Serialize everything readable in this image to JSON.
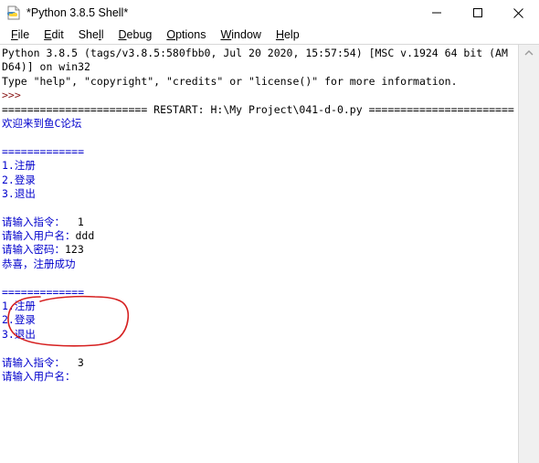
{
  "window": {
    "title": "*Python 3.8.5 Shell*",
    "icon": "python-idle-icon",
    "controls": [
      {
        "name": "minimize-button",
        "glyph": "minimize"
      },
      {
        "name": "maximize-button",
        "glyph": "maximize"
      },
      {
        "name": "close-button",
        "glyph": "close"
      }
    ]
  },
  "menubar": {
    "items": [
      {
        "label": "File",
        "mnemonic": "F"
      },
      {
        "label": "Edit",
        "mnemonic": "E"
      },
      {
        "label": "Shell",
        "mnemonic": "l"
      },
      {
        "label": "Debug",
        "mnemonic": "D"
      },
      {
        "label": "Options",
        "mnemonic": "O"
      },
      {
        "label": "Window",
        "mnemonic": "W"
      },
      {
        "label": "Help",
        "mnemonic": "H"
      }
    ]
  },
  "shell": {
    "lines": [
      {
        "text": "Python 3.8.5 (tags/v3.8.5:580fbb0, Jul 20 2020, 15:57:54) [MSC v.1924 64 bit (AM",
        "color": "black"
      },
      {
        "text": "D64)] on win32",
        "color": "black"
      },
      {
        "text": "Type \"help\", \"copyright\", \"credits\" or \"license()\" for more information.",
        "color": "black"
      },
      {
        "text": ">>>",
        "color": "red"
      },
      {
        "text": "======================= RESTART: H:\\My Project\\041-d-0.py =======================",
        "color": "black"
      },
      {
        "text": "欢迎来到鱼C论坛",
        "color": "blue"
      },
      {
        "text": "",
        "color": "black"
      },
      {
        "text": "=============",
        "color": "blue"
      },
      {
        "text": "1.注册",
        "color": "blue"
      },
      {
        "text": "2.登录",
        "color": "blue"
      },
      {
        "text": "3.退出",
        "color": "blue"
      },
      {
        "text": "",
        "color": "black"
      },
      {
        "text": "请输入指令： ",
        "color": "blue",
        "input": " 1"
      },
      {
        "text": "请输入用户名：",
        "color": "blue",
        "input": "ddd"
      },
      {
        "text": "请输入密码：",
        "color": "blue",
        "input": "123"
      },
      {
        "text": "恭喜，注册成功",
        "color": "blue"
      },
      {
        "text": "",
        "color": "black"
      },
      {
        "text": "=============",
        "color": "blue"
      },
      {
        "text": "1.注册",
        "color": "blue"
      },
      {
        "text": "2.登录",
        "color": "blue"
      },
      {
        "text": "3.退出",
        "color": "blue"
      },
      {
        "text": "",
        "color": "black"
      },
      {
        "text": "请输入指令： ",
        "color": "blue",
        "input": " 3"
      },
      {
        "text": "请输入用户名：",
        "color": "blue"
      }
    ]
  },
  "scrollbar": {
    "name": "vertical-scrollbar",
    "up_arrow": "chevron-up-icon"
  },
  "annotation": {
    "shape": "hand-drawn-ellipse",
    "color": "#d62020",
    "targets": "请输入指令： 3 / 请输入用户名："
  },
  "colors": {
    "output_blue": "#0000cc",
    "prompt_red": "#8b1a1a",
    "text_black": "#000000",
    "background": "#ffffff",
    "annotation_red": "#d62020"
  }
}
